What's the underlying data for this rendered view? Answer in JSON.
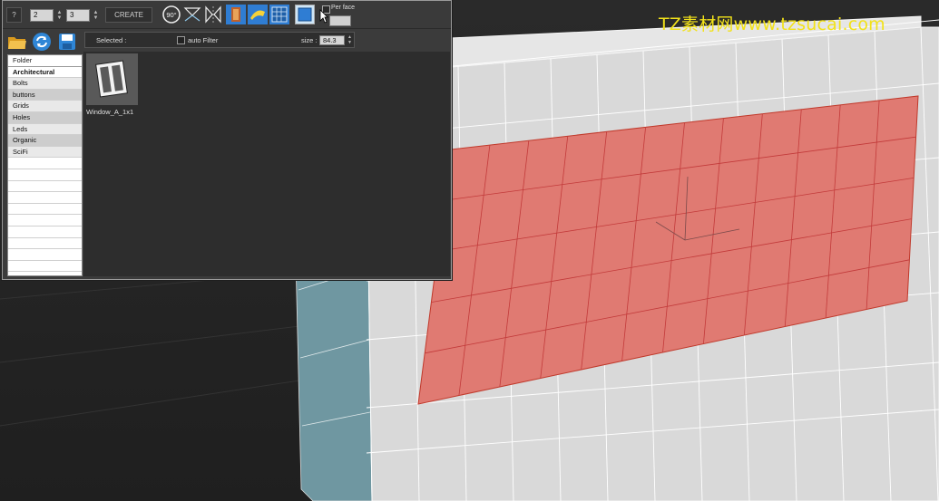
{
  "watermark": "TZ素材网www.tzsucai.com",
  "toolbar": {
    "help_label": "?",
    "spinner_a_value": "2",
    "spinner_b_value": "3",
    "create_label": "CREATE",
    "rotate_label": "90°",
    "per_face_label": "Per face"
  },
  "file_buttons": {
    "folder_icon": "folder-open-icon",
    "refresh_icon": "refresh-icon",
    "save_icon": "save-icon"
  },
  "selection_bar": {
    "selected_label": "Selected :",
    "auto_filter_label": "auto Filter",
    "size_label": "size :",
    "size_value": "84.3"
  },
  "folders": {
    "header": "Folder",
    "items": [
      "Architectural",
      "Bolts",
      "buttons",
      "Grids",
      "Holes",
      "Leds",
      "Organic",
      "SciFi"
    ]
  },
  "assets": [
    {
      "name": "Window_A_1x1",
      "icon": "window-icon"
    }
  ],
  "colors": {
    "selection_red": "#e07a72",
    "mesh_light": "#d9d9d9",
    "mesh_side": "#6f97a1",
    "toolbar_blue": "#2f7dd3",
    "watermark": "#f2e21a"
  }
}
